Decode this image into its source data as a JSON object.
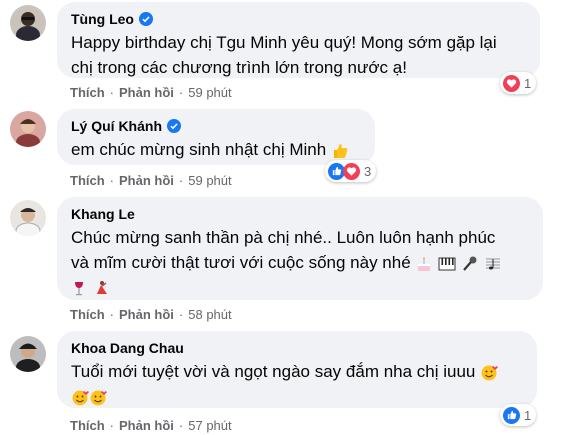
{
  "actions": {
    "like": "Thích",
    "reply": "Phản hồi",
    "separator": "·"
  },
  "comments": [
    {
      "name": "Tùng Leo",
      "verified": true,
      "line1": "Happy birthday chị Tgu Minh yêu quý! Mong sớm gặp lại",
      "line2": "chị trong các chương trình lớn trong nước ạ!",
      "time": "59 phút",
      "reaction_count": "1",
      "reactions": [
        "heart"
      ]
    },
    {
      "name": "Lý Quí Khánh",
      "verified": true,
      "line1": "em chúc mừng sinh nhật chị Minh",
      "time": "59 phút",
      "reaction_count": "3",
      "reactions": [
        "like",
        "heart"
      ],
      "emoji": [
        "thumbs-up-emoji"
      ]
    },
    {
      "name": "Khang Le",
      "verified": false,
      "line1": "Chúc mừng sanh thần pà chị nhé.. Luôn luôn hạnh phúc",
      "line2": "và mĩm cười thật tươi với cuộc sống này nhé",
      "time": "58 phút",
      "emoji": [
        "birthday-cake-emoji",
        "piano-emoji",
        "microphone-emoji",
        "music-score-emoji",
        "wine-glass-emoji",
        "dancer-emoji"
      ]
    },
    {
      "name": "Khoa Dang Chau",
      "verified": false,
      "line1": "Tuổi mới tuyệt vời và ngọt ngào say đắm nha chị iuuu",
      "time": "57 phút",
      "reaction_count": "1",
      "reactions": [
        "like"
      ],
      "emoji": [
        "smiling-face-with-hearts-emoji",
        "smiling-face-with-hearts-emoji",
        "smiling-face-with-hearts-emoji"
      ]
    }
  ],
  "colors": {
    "bubble": "#f0f2f5",
    "verified": "#1877f2",
    "meta": "#65676b",
    "heart": "#f33e58",
    "like": "#1877f2"
  }
}
